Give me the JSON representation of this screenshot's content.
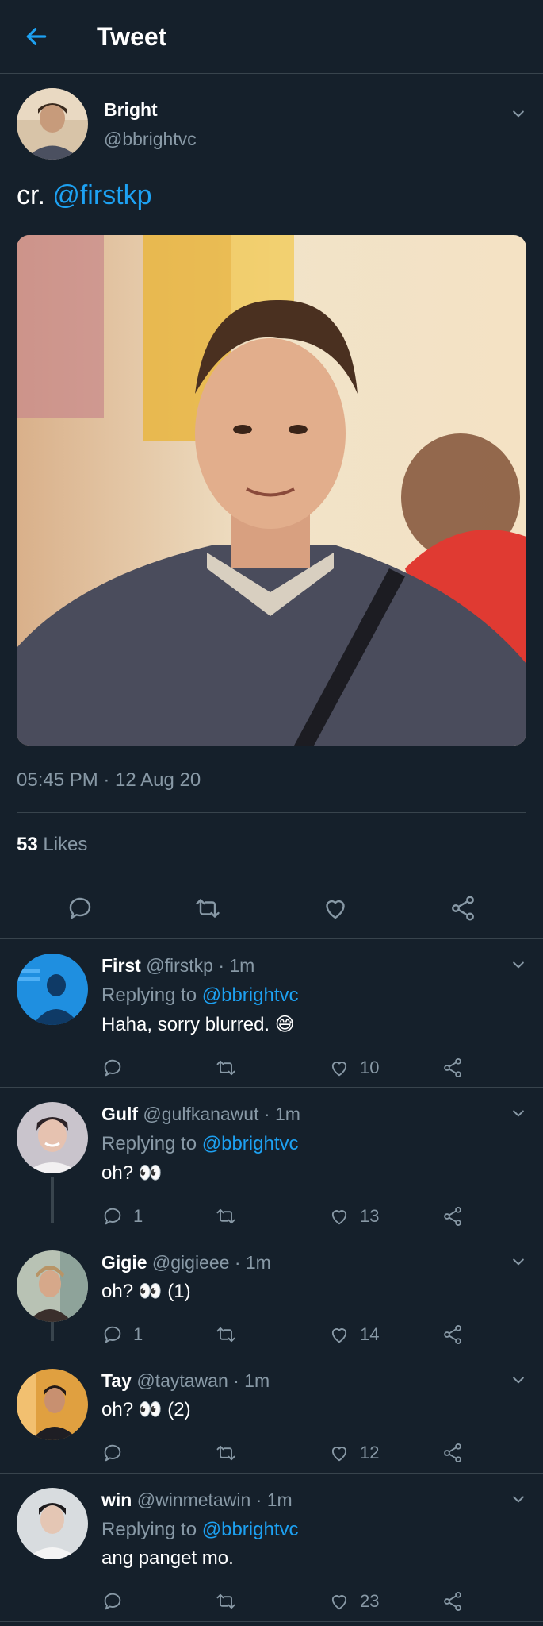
{
  "header": {
    "title": "Tweet"
  },
  "tweet": {
    "author_name": "Bright",
    "author_handle": "@bbrightvc",
    "text_prefix": "cr. ",
    "text_mention": "@firstkp",
    "timestamp": "05:45 PM · 12 Aug 20",
    "likes_count": "53",
    "likes_label": "Likes"
  },
  "replies": [
    {
      "name": "First",
      "handle": "@firstkp",
      "time": "· 1m",
      "replying_prefix": "Replying to ",
      "replying_to": "@bbrightvc",
      "text": "Haha, sorry blurred. 😅",
      "reply_count": "",
      "like_count": "10"
    },
    {
      "name": "Gulf",
      "handle": "@gulfkanawut",
      "time": "· 1m",
      "replying_prefix": "Replying to ",
      "replying_to": "@bbrightvc",
      "text": "oh? 👀",
      "reply_count": "1",
      "like_count": "13"
    },
    {
      "name": "Gigie",
      "handle": "@gigieee",
      "time": "· 1m",
      "text": "oh? 👀 (1)",
      "reply_count": "1",
      "like_count": "14"
    },
    {
      "name": "Tay",
      "handle": "@taytawan",
      "time": "· 1m",
      "text": "oh? 👀 (2)",
      "reply_count": "",
      "like_count": "12"
    },
    {
      "name": "win",
      "handle": "@winmetawin",
      "time": "· 1m",
      "replying_prefix": "Replying to ",
      "replying_to": "@bbrightvc",
      "text": "ang panget mo.",
      "reply_count": "",
      "like_count": "23"
    }
  ],
  "colors": {
    "background": "#15202b",
    "accent": "#1da1f2",
    "muted": "#8899a6",
    "divider": "#38444d"
  },
  "icons": [
    "back-arrow-icon",
    "chevron-down-icon",
    "reply-icon",
    "retweet-icon",
    "heart-icon",
    "share-icon"
  ]
}
